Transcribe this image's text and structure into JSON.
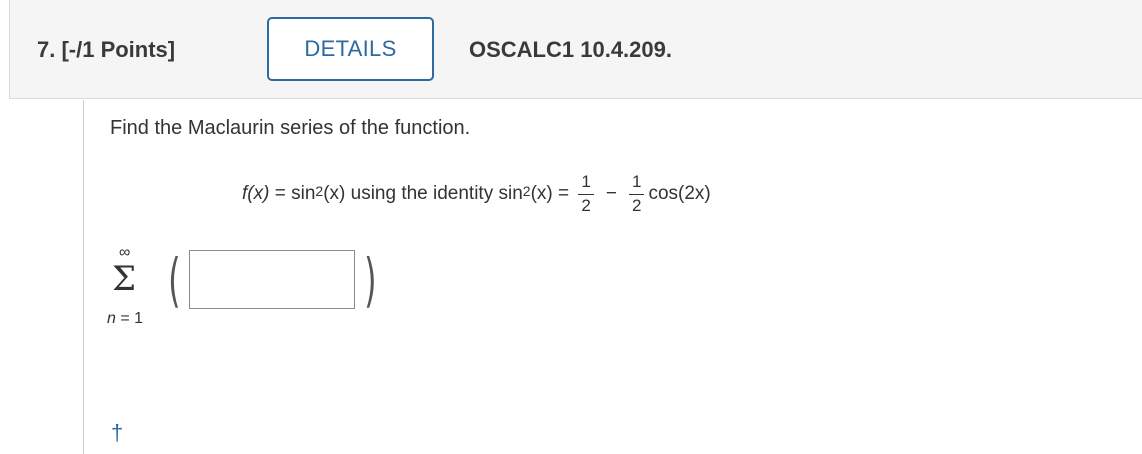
{
  "question": {
    "number_label": "7. [-/1 Points]",
    "details_label": "DETAILS",
    "code": "OSCALC1 10.4.209."
  },
  "prompt": "Find the Maclaurin series of the function.",
  "formula": {
    "fx": "f(x)",
    "equals1": " = ",
    "sin": "sin",
    "sq1": "2",
    "arg1": "(x)",
    "using_text": " using the identity sin",
    "sq2": "2",
    "arg2": "(x)",
    "equals2": " = ",
    "frac1_num": "1",
    "frac1_den": "2",
    "minus": "−",
    "frac2_num": "1",
    "frac2_den": "2",
    "cos_term": "cos(2x)"
  },
  "summation": {
    "upper": "∞",
    "symbol": "Σ",
    "lower_var": "n",
    "lower_eq": " = 1",
    "left_paren": "(",
    "right_paren": ")"
  },
  "answer_input": {
    "value": "",
    "placeholder": ""
  },
  "footnote_marker": "†",
  "colors": {
    "accent": "#2c6aa0",
    "header_bg": "#f5f5f5",
    "text": "#333333"
  }
}
